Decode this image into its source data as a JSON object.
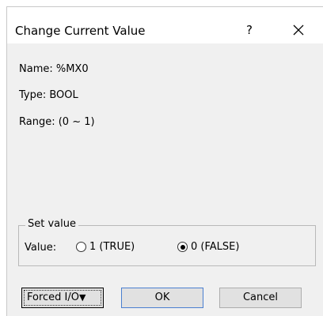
{
  "dialog": {
    "title": "Change Current Value",
    "help_label": "?",
    "close_icon": "close-icon"
  },
  "info": {
    "name": "Name:  %MX0",
    "type": "Type:  BOOL",
    "range": "Range: (0 ~ 1)"
  },
  "set_value": {
    "group_label": "Set value",
    "value_label": "Value:",
    "options": [
      {
        "label": "1 (TRUE)",
        "checked": false
      },
      {
        "label": "0 (FALSE)",
        "checked": true
      }
    ]
  },
  "buttons": {
    "forced_label": "Forced I/O",
    "forced_arrow": "▼",
    "ok_label": "OK",
    "cancel_label": "Cancel"
  }
}
